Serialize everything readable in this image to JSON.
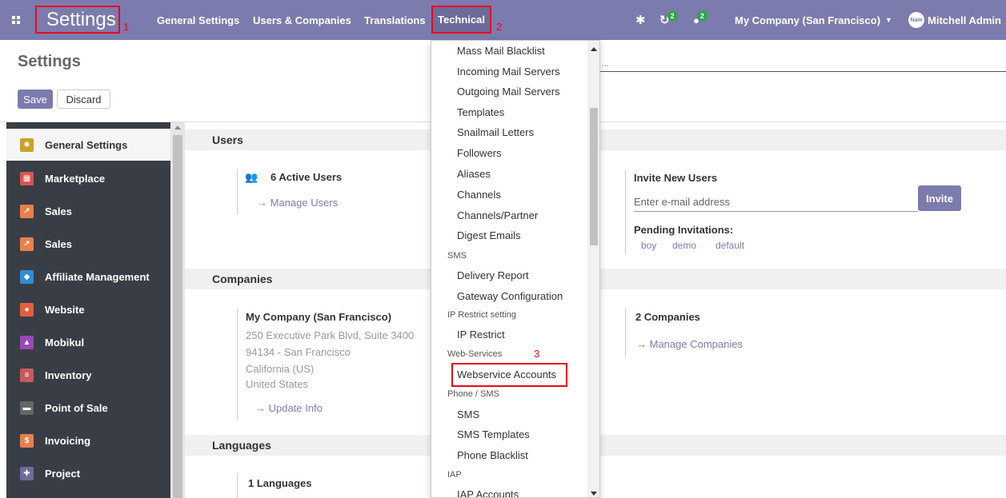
{
  "navbar": {
    "brand": "Settings",
    "brand_annotation": "1",
    "menu": [
      "General Settings",
      "Users & Companies",
      "Translations"
    ],
    "technical": "Technical",
    "technical_annotation": "2",
    "activity_count": "2",
    "messages_count": "2",
    "company": "My Company (San Francisco)",
    "user": "Mitchell Admin",
    "avatar_text": "Nam"
  },
  "control_panel": {
    "title": "Settings",
    "save": "Save",
    "discard": "Discard",
    "search_placeholder": "..."
  },
  "sidebar": {
    "items": [
      {
        "label": "General Settings",
        "color": "#c9a227"
      },
      {
        "label": "Marketplace",
        "color": "#d9534f"
      },
      {
        "label": "Sales",
        "color": "#e8814b"
      },
      {
        "label": "Sales",
        "color": "#e8814b"
      },
      {
        "label": "Affiliate Management",
        "color": "#2f8fd8"
      },
      {
        "label": "Website",
        "color": "#e0603f"
      },
      {
        "label": "Mobikul",
        "color": "#9b47b5"
      },
      {
        "label": "Inventory",
        "color": "#c75a5a"
      },
      {
        "label": "Point of Sale",
        "color": "#666666"
      },
      {
        "label": "Invoicing",
        "color": "#e8814b"
      },
      {
        "label": "Project",
        "color": "#6c6b9a"
      }
    ]
  },
  "sections": {
    "users": {
      "title": "Users",
      "active_users": "6 Active Users",
      "manage_users": "→ Manage Users",
      "invite_title": "Invite New Users",
      "invite_placeholder": "Enter e-mail address",
      "invite_button": "Invite",
      "pending_title": "Pending Invitations:",
      "pending": [
        "boy",
        "demo",
        "default"
      ]
    },
    "companies": {
      "title": "Companies",
      "company_name": "My Company (San Francisco)",
      "address": [
        "250 Executive Park Blvd, Suite 3400",
        "94134 - San Francisco",
        "California (US)",
        "United States"
      ],
      "update_info": "→ Update Info",
      "count": "2 Companies",
      "manage": "→ Manage Companies"
    },
    "languages": {
      "title": "Languages",
      "count": "1 Languages"
    }
  },
  "dropdown": {
    "items": [
      {
        "type": "item",
        "label": "Mass Mail Blacklist"
      },
      {
        "type": "item",
        "label": "Incoming Mail Servers"
      },
      {
        "type": "item",
        "label": "Outgoing Mail Servers"
      },
      {
        "type": "item",
        "label": "Templates"
      },
      {
        "type": "item",
        "label": "Snailmail Letters"
      },
      {
        "type": "item",
        "label": "Followers"
      },
      {
        "type": "item",
        "label": "Aliases"
      },
      {
        "type": "item",
        "label": "Channels"
      },
      {
        "type": "item",
        "label": "Channels/Partner"
      },
      {
        "type": "item",
        "label": "Digest Emails"
      },
      {
        "type": "header",
        "label": "SMS"
      },
      {
        "type": "item",
        "label": "Delivery Report"
      },
      {
        "type": "item",
        "label": "Gateway Configuration"
      },
      {
        "type": "header",
        "label": "IP Restrict setting"
      },
      {
        "type": "item",
        "label": "IP Restrict"
      },
      {
        "type": "header",
        "label": "Web-Services"
      },
      {
        "type": "item",
        "label": "Webservice Accounts"
      },
      {
        "type": "header",
        "label": "Phone / SMS"
      },
      {
        "type": "item",
        "label": "SMS"
      },
      {
        "type": "item",
        "label": "SMS Templates"
      },
      {
        "type": "item",
        "label": "Phone Blacklist"
      },
      {
        "type": "header",
        "label": "IAP"
      },
      {
        "type": "item",
        "label": "IAP Accounts"
      }
    ],
    "webservices_annotation": "3"
  }
}
